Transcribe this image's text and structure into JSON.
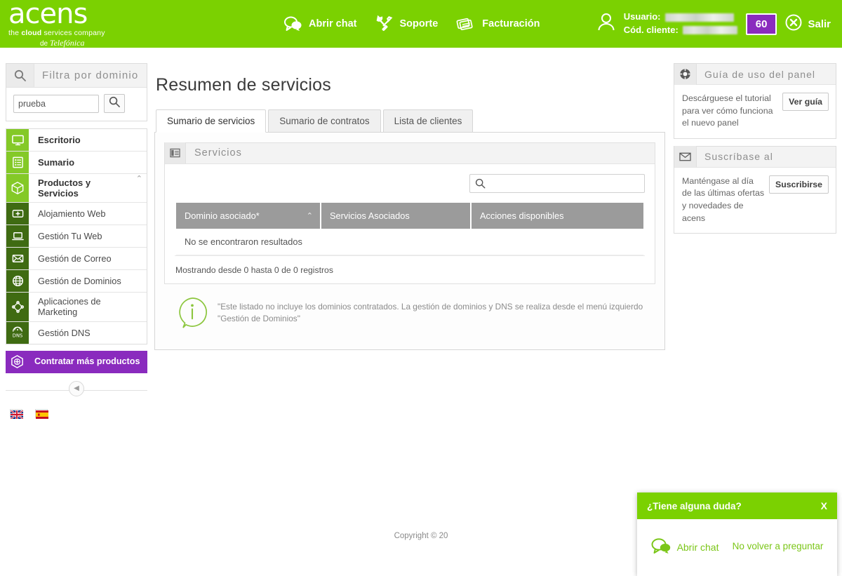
{
  "header": {
    "logo": {
      "word": "acens",
      "tagline_plain_1": "the ",
      "tagline_bold": "cloud",
      "tagline_plain_2": " services company",
      "telefonica_prefix": "de ",
      "telefonica": "Telefónica"
    },
    "nav": [
      {
        "label": "Abrir chat",
        "icon": "chat-icon"
      },
      {
        "label": "Soporte",
        "icon": "tools-icon"
      },
      {
        "label": "Facturación",
        "icon": "invoice-icon"
      }
    ],
    "user_label": "Usuario:",
    "client_label": "Cód. cliente:",
    "user_value": "",
    "client_value": "",
    "badge": "60",
    "logout": "Salir",
    "green": "#7bd101",
    "purple": "#8a2bbe"
  },
  "sidebar": {
    "filter_title": "Filtra por dominio",
    "filter_value": "prueba",
    "filter_placeholder": "",
    "menu": [
      {
        "label": "Escritorio",
        "icon": "monitor-icon",
        "level": "top"
      },
      {
        "label": "Sumario",
        "icon": "list-icon",
        "level": "top"
      },
      {
        "label": "Productos y Servicios",
        "icon": "cube-icon",
        "level": "top",
        "caret": "⌃"
      },
      {
        "label": "Alojamiento Web",
        "icon": "server-plus-icon",
        "level": "sub"
      },
      {
        "label": "Gestión Tu Web",
        "icon": "laptop-icon",
        "level": "sub"
      },
      {
        "label": "Gestión de Correo",
        "icon": "envelope-icon",
        "level": "sub"
      },
      {
        "label": "Gestión de Dominios",
        "icon": "globe-icon",
        "level": "sub"
      },
      {
        "label": "Aplicaciones de Marketing",
        "icon": "network-icon",
        "level": "sub"
      },
      {
        "label": "Gestión DNS",
        "icon": "dns-icon",
        "level": "sub"
      }
    ],
    "contratar": "Contratar más productos",
    "collapse_icon": "chevron-left-icon",
    "flags": [
      {
        "name": "flag-uk"
      },
      {
        "name": "flag-spain"
      }
    ]
  },
  "main": {
    "title": "Resumen de servicios",
    "tabs": [
      {
        "label": "Sumario de servicios",
        "active": true
      },
      {
        "label": "Sumario de contratos",
        "active": false
      },
      {
        "label": "Lista de clientes",
        "active": false
      }
    ],
    "card_title": "Servicios",
    "search_value": "",
    "search_placeholder": "",
    "table": {
      "columns": [
        "Dominio asociado*",
        "Servicios Asociados",
        "Acciones disponibles"
      ],
      "sort_caret": "⌃",
      "empty_message": "No se encontraron resultados",
      "rows": []
    },
    "showing": "Mostrando desde 0 hasta 0 de 0 registros",
    "note": "\"Este listado no incluye los dominios contratados. La gestión de dominios y DNS se realiza desde el menú izquierdo \"Gestión de Dominios\""
  },
  "right_panels": [
    {
      "title": "Guía de uso del panel",
      "icon": "help-circle-icon",
      "text": "Descárguese el tutorial para ver cómo funciona el nuevo panel",
      "button": "Ver guía"
    },
    {
      "title": "Suscríbase al",
      "icon": "envelope-icon",
      "text": "Manténgase al día de las últimas ofertas y novedades de acens",
      "button": "Suscribirse"
    }
  ],
  "footer": {
    "copyright": "Copyright © 20"
  },
  "chat_popup": {
    "title": "¿Tiene alguna duda?",
    "close": "X",
    "open_chat": "Abrir chat",
    "never_ask": "No volver a preguntar"
  }
}
